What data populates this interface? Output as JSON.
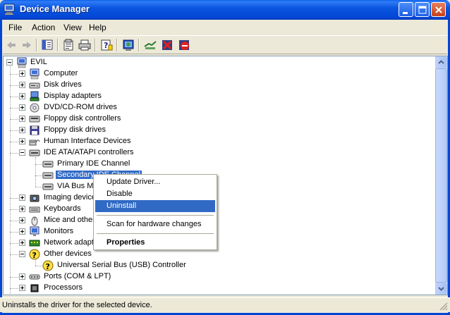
{
  "window": {
    "title": "Device Manager",
    "controls": [
      "minimize",
      "maximize",
      "close"
    ]
  },
  "menu": [
    "File",
    "Action",
    "View",
    "Help"
  ],
  "toolbar": {
    "icons": [
      "back-arrow-icon",
      "forward-arrow-icon",
      "show-hide-tree-icon",
      "properties-icon",
      "print-icon",
      "help-icon",
      "scan-hardware-icon",
      "update-driver-icon",
      "uninstall-icon",
      "disable-icon"
    ]
  },
  "tree": {
    "root": "EVIL",
    "categories": [
      {
        "label": "Computer",
        "icon": "computer-icon",
        "expanded": false
      },
      {
        "label": "Disk drives",
        "icon": "disk-drive-icon",
        "expanded": false
      },
      {
        "label": "Display adapters",
        "icon": "display-adapter-icon",
        "expanded": false
      },
      {
        "label": "DVD/CD-ROM drives",
        "icon": "cdrom-icon",
        "expanded": false
      },
      {
        "label": "Floppy disk controllers",
        "icon": "floppy-controller-icon",
        "expanded": false
      },
      {
        "label": "Floppy disk drives",
        "icon": "floppy-drive-icon",
        "expanded": false
      },
      {
        "label": "Human Interface Devices",
        "icon": "hid-icon",
        "expanded": false
      },
      {
        "label": "IDE ATA/ATAPI controllers",
        "icon": "ide-controller-icon",
        "expanded": true,
        "children": [
          "Primary IDE Channel",
          "Secondary IDE Channel",
          "VIA Bus Ma"
        ]
      },
      {
        "label": "Imaging device",
        "icon": "imaging-icon",
        "expanded": false
      },
      {
        "label": "Keyboards",
        "icon": "keyboard-icon",
        "expanded": false
      },
      {
        "label": "Mice and other",
        "icon": "mouse-icon",
        "expanded": false
      },
      {
        "label": "Monitors",
        "icon": "monitor-icon",
        "expanded": false
      },
      {
        "label": "Network adapt",
        "icon": "network-icon",
        "expanded": false
      },
      {
        "label": "Other devices",
        "icon": "unknown-device-icon",
        "expanded": true,
        "children": [
          "Universal Serial Bus (USB) Controller"
        ]
      },
      {
        "label": "Ports (COM & LPT)",
        "icon": "port-icon",
        "expanded": false
      },
      {
        "label": "Processors",
        "icon": "processor-icon",
        "expanded": false
      }
    ],
    "selected": "Secondary IDE Channel"
  },
  "context_menu": {
    "items": [
      "Update Driver...",
      "Disable",
      "Uninstall",
      "Scan for hardware changes",
      "Properties"
    ],
    "highlighted": "Uninstall",
    "default": "Properties"
  },
  "status": "Uninstalls the driver for the selected device.",
  "colors": {
    "titlebar": "#0346d6",
    "selection": "#316ac5",
    "chrome": "#ece9d8"
  }
}
